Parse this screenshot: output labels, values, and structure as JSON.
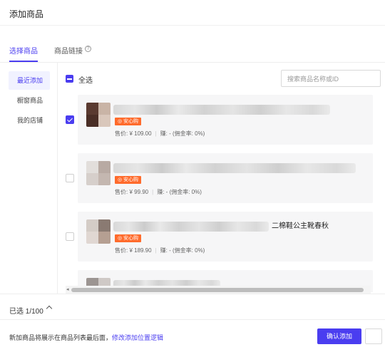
{
  "header": {
    "title": "添加商品"
  },
  "tabs": [
    {
      "label": "选择商品",
      "active": true
    },
    {
      "label": "商品链接",
      "active": false
    }
  ],
  "sidebar": {
    "items": [
      {
        "label": "最近添加",
        "active": true
      },
      {
        "label": "橱窗商品",
        "active": false
      },
      {
        "label": "我的店铺",
        "active": false
      }
    ]
  },
  "list_header": {
    "select_all_label": "全选",
    "search_placeholder": "搜索商品名称或ID"
  },
  "products": [
    {
      "checked": true,
      "title_visible_tail": "",
      "badge": "安心购",
      "price": "售价: ¥ 109.00",
      "earn": "赚: -",
      "commission": "(佣金率: 0%)"
    },
    {
      "checked": false,
      "title_visible_tail": "",
      "badge": "安心购",
      "price": "售价: ¥ 99.90",
      "earn": "赚: -",
      "commission": "(佣金率: 0%)"
    },
    {
      "checked": false,
      "title_visible_tail": "二棉鞋公主靴春秋",
      "badge": "安心购",
      "price": "售价: ¥ 189.90",
      "earn": "赚: -",
      "commission": "(佣金率: 0%)"
    }
  ],
  "selection": {
    "text": "已选 1/100"
  },
  "footer": {
    "note": "新加商品将展示在商品列表最后面，",
    "link": "修改添加位置逻辑",
    "confirm_label": "确认添加"
  },
  "colors": {
    "accent": "#4a3df0",
    "badge": "#ff6b2c"
  }
}
